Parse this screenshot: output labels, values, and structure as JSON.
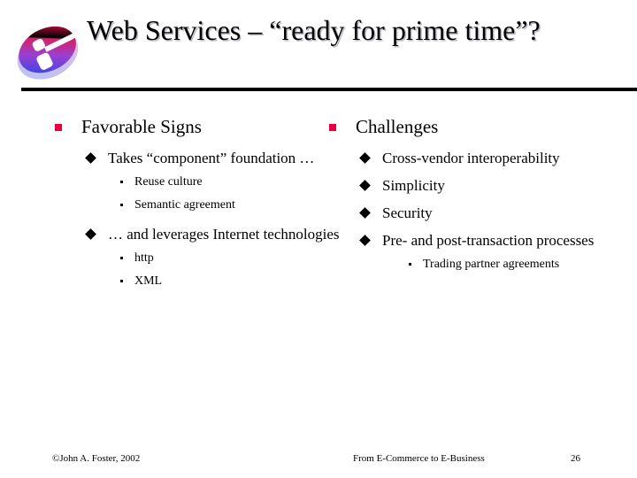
{
  "slide": {
    "title": "Web Services – “ready for prime time”?",
    "logo_icon": "stylized-e-logo",
    "logo_colors": {
      "top": "#e8174a",
      "mid": "#a23ad2",
      "bottom": "#2a47e8",
      "halo": "#c8c8ee"
    },
    "accent_bullet_color": "#e8003c"
  },
  "columns": {
    "left": {
      "heading": "Favorable Signs",
      "groups": [
        {
          "text": "Takes “component” foundation …",
          "subitems": [
            "Reuse culture",
            "Semantic agreement"
          ]
        },
        {
          "text": "… and leverages Internet technologies",
          "subitems": [
            "http",
            "XML"
          ]
        }
      ]
    },
    "right": {
      "heading": "Challenges",
      "groups": [
        {
          "text": "Cross-vendor interoperability",
          "subitems": []
        },
        {
          "text": "Simplicity",
          "subitems": []
        },
        {
          "text": "Security",
          "subitems": []
        },
        {
          "text": "Pre- and post-transaction processes",
          "subitems": [
            "Trading partner agreements"
          ]
        }
      ]
    }
  },
  "footer": {
    "copyright": "©John A. Foster,  2002",
    "source": "From E-Commerce to E-Business",
    "page_number": "26"
  }
}
